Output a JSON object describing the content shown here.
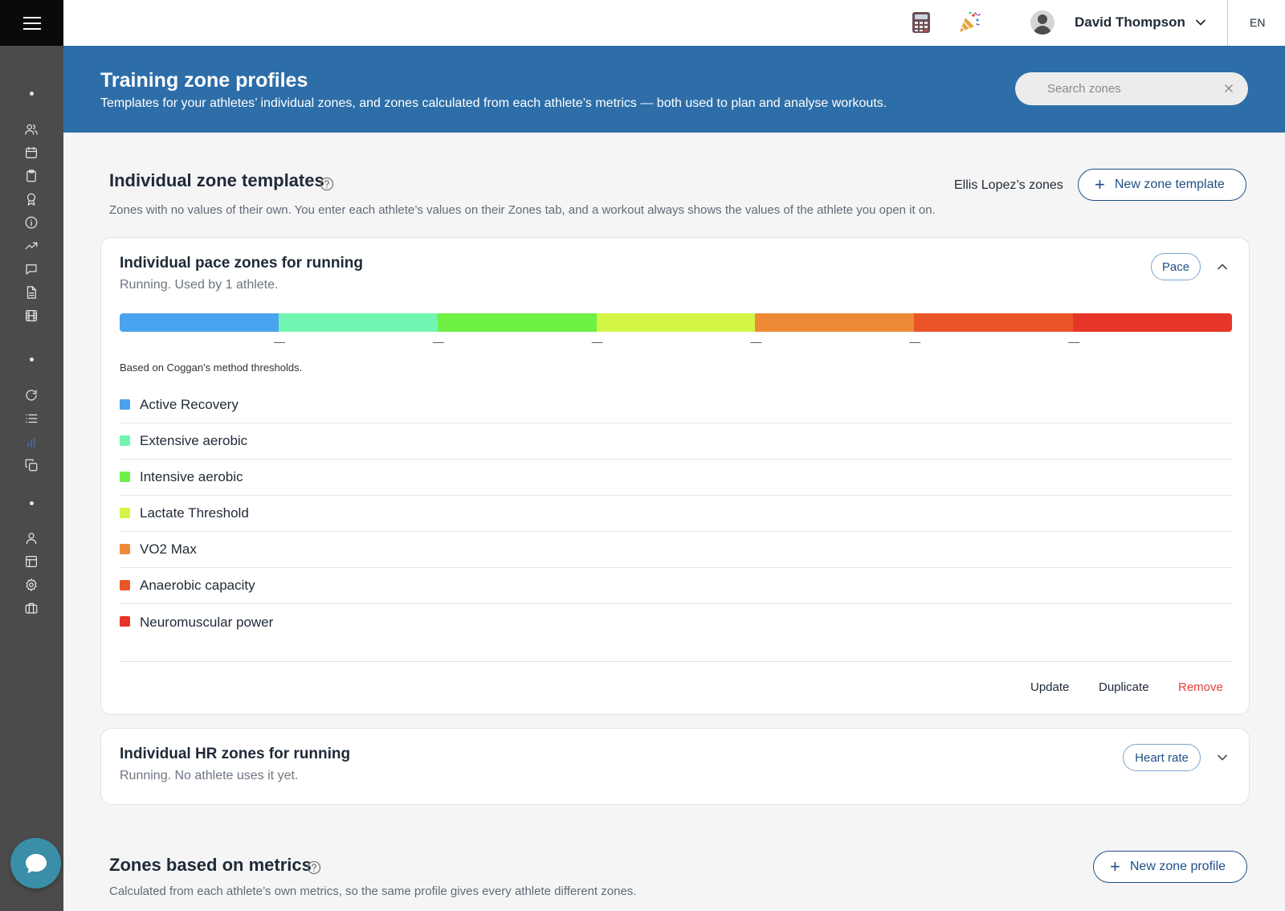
{
  "sidebar": {
    "icons": [
      "users-icon",
      "calendar-icon",
      "clipboard-icon",
      "award-icon",
      "info-icon",
      "trending-up-icon",
      "message-icon",
      "file-text-icon",
      "film-icon",
      "refresh-icon",
      "list-icon",
      "bar-chart-icon",
      "copy-icon",
      "user-icon",
      "layout-icon",
      "settings-icon",
      "briefcase-icon"
    ],
    "active_icon": "bar-chart-icon"
  },
  "topbar": {
    "user_name": "David Thompson",
    "language": "EN"
  },
  "header": {
    "title": "Training zone profiles",
    "subtitle": "Templates for your athletes’ individual zones, and zones calculated from each athlete’s metrics — both used to plan and analyse workouts.",
    "search_placeholder": "Search zones"
  },
  "individual_templates": {
    "title": "Individual zone templates",
    "description": "Zones with no values of their own. You enter each athlete’s values on their Zones tab, and a workout always shows the values of the athlete you open it on.",
    "athlete_link": "Ellis Lopez’s zones",
    "new_button": "New zone template"
  },
  "pace_card": {
    "title": "Individual pace zones for running",
    "subtitle": "Running. Used by 1 athlete.",
    "badge": "Pace",
    "dash": "—",
    "based_on": "Based on Coggan's method thresholds.",
    "zones": [
      {
        "name": "Active Recovery",
        "color": "#4aa3ee"
      },
      {
        "name": "Extensive aerobic",
        "color": "#72f5b0"
      },
      {
        "name": "Intensive aerobic",
        "color": "#6ef045"
      },
      {
        "name": "Lactate Threshold",
        "color": "#d2f546"
      },
      {
        "name": "VO2 Max",
        "color": "#ee8a35"
      },
      {
        "name": "Anaerobic capacity",
        "color": "#ea5528"
      },
      {
        "name": "Neuromuscular power",
        "color": "#e73629"
      }
    ],
    "actions": {
      "update": "Update",
      "duplicate": "Duplicate",
      "remove": "Remove"
    }
  },
  "hr_card": {
    "title": "Individual HR zones for running",
    "subtitle": "Running. No athlete uses it yet.",
    "badge": "Heart rate"
  },
  "metrics_section": {
    "title": "Zones based on metrics",
    "description": "Calculated from each athlete’s own metrics, so the same profile gives every athlete different zones.",
    "new_button": "New zone profile"
  },
  "colors": {
    "header_band": "#2d6ea8",
    "accent": "#1e4f85",
    "remove": "#e5413a"
  }
}
